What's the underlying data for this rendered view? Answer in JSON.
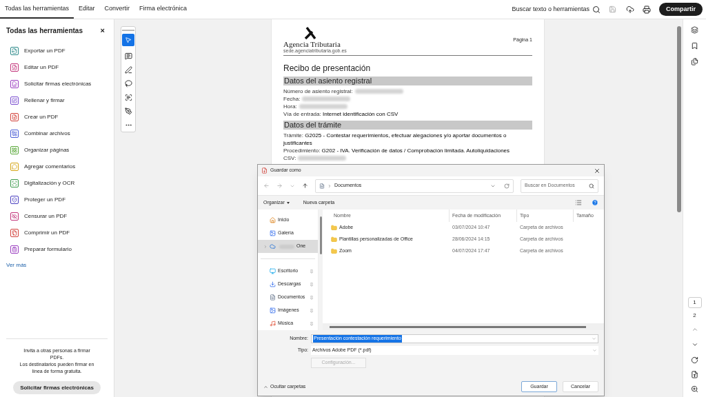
{
  "top_tabs": [
    {
      "label": "Todas las herramientas",
      "selected": true
    },
    {
      "label": "Editar",
      "selected": false
    },
    {
      "label": "Convertir",
      "selected": false
    },
    {
      "label": "Firma electrónica",
      "selected": false
    }
  ],
  "search_label": "Buscar texto o herramientas",
  "share_button": "Compartir",
  "tools_panel": {
    "title": "Todas las herramientas",
    "close": "×",
    "items": [
      {
        "label": "Exportar un PDF",
        "color": "#2d8a8a"
      },
      {
        "label": "Editar un PDF",
        "color": "#c2347a"
      },
      {
        "label": "Solicitar firmas electrónicas",
        "color": "#9b3fc0"
      },
      {
        "label": "Rellenar y firmar",
        "color": "#7b4fd0"
      },
      {
        "label": "Crear un PDF",
        "color": "#d2413a"
      },
      {
        "label": "Combinar archivos",
        "color": "#4b5fd6"
      },
      {
        "label": "Organizar páginas",
        "color": "#5aa83a"
      },
      {
        "label": "Agregar comentarios",
        "color": "#d6a514"
      },
      {
        "label": "Digitalización y OCR",
        "color": "#3a9a4a"
      },
      {
        "label": "Proteger un PDF",
        "color": "#4a3fc0"
      },
      {
        "label": "Censurar un PDF",
        "color": "#c2347a"
      },
      {
        "label": "Comprimir un PDF",
        "color": "#d2413a"
      },
      {
        "label": "Preparar formulario",
        "color": "#9b3fc0"
      }
    ],
    "more_link": "Ver más",
    "promo_lines": [
      "Invita a otras personas a firmar PDFs.",
      "Los destinatarios pueden firmar en línea de forma gratuita."
    ],
    "promo_button": "Solicitar firmas electrónicas"
  },
  "document": {
    "logo_name": "Agencia Tributaria",
    "logo_url": "sede.agenciatributaria.gob.es",
    "page_label": "Página 1",
    "title": "Recibo de presentación",
    "sections": [
      {
        "heading": "Datos del asiento registral",
        "fields": [
          {
            "label": "Número de asiento registral:",
            "redacted": true
          },
          {
            "label": "Fecha:",
            "redacted": true
          },
          {
            "label": "Hora:",
            "redacted": true
          },
          {
            "label": "Vía de entrada:",
            "value": "Internet identificación con CSV",
            "redacted": false
          }
        ]
      },
      {
        "heading": "Datos del trámite",
        "fields": [
          {
            "label": "Trámite:",
            "value": "G2025 - Contestar requerimientos, efectuar alegaciones y/o aportar documentos o justificantes",
            "redacted": false
          },
          {
            "label": "Procedimiento:",
            "value": "G202 - IVA. Verificación de datos / Comprobación limitada. Autoliquidaciones",
            "redacted": false
          },
          {
            "label": "CSV:",
            "redacted": true
          }
        ]
      }
    ]
  },
  "pages": [
    {
      "label": "1",
      "selected": true
    },
    {
      "label": "2",
      "selected": false
    }
  ],
  "dialog": {
    "title": "Guardar como",
    "path": "Documentos",
    "search_placeholder": "Buscar en Documentos",
    "organize": "Organizar",
    "new_folder": "Nueva carpeta",
    "nav": [
      {
        "label": "Inicio",
        "kind": "home",
        "pinned": false,
        "selected": false,
        "redacted": false
      },
      {
        "label": "Galería",
        "kind": "gallery",
        "pinned": false,
        "selected": false,
        "redacted": false
      },
      {
        "label": "One",
        "kind": "cloud",
        "pinned": false,
        "selected": true,
        "redacted": true
      },
      {
        "label": "Escritorio",
        "kind": "desktop",
        "pinned": true,
        "selected": false,
        "redacted": false
      },
      {
        "label": "Descargas",
        "kind": "download",
        "pinned": true,
        "selected": false,
        "redacted": false
      },
      {
        "label": "Documentos",
        "kind": "documents",
        "pinned": true,
        "selected": false,
        "redacted": false
      },
      {
        "label": "Imágenes",
        "kind": "pictures",
        "pinned": true,
        "selected": false,
        "redacted": false
      },
      {
        "label": "Música",
        "kind": "music",
        "pinned": true,
        "selected": false,
        "redacted": false
      }
    ],
    "columns": [
      "Nombre",
      "Fecha de modificación",
      "Tipo",
      "Tamaño"
    ],
    "rows": [
      {
        "name": "Adobe",
        "date": "03/07/2024 10:47",
        "type": "Carpeta de archivos"
      },
      {
        "name": "Plantillas personalizadas de Office",
        "date": "28/06/2024 14:15",
        "type": "Carpeta de archivos"
      },
      {
        "name": "Zoom",
        "date": "04/07/2024 17:47",
        "type": "Carpeta de archivos"
      }
    ],
    "name_label": "Nombre:",
    "name_value": "Presentación contestación requerimiento",
    "type_label": "Tipo:",
    "type_value": "Archivos Adobe PDF (*.pdf)",
    "config_button": {
      "label": "Configuración...",
      "disabled": true
    },
    "hide_folders": "Ocultar carpetas",
    "save": "Guardar",
    "cancel": "Cancelar"
  }
}
